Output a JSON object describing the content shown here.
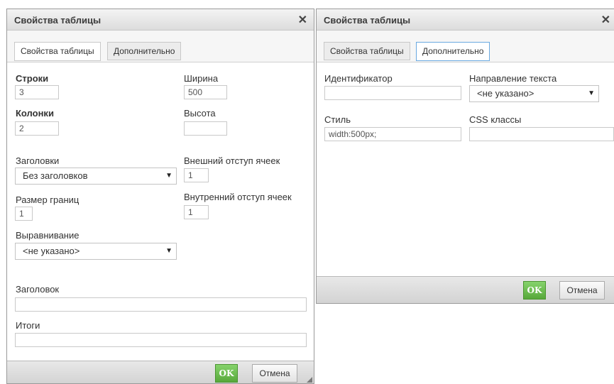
{
  "left": {
    "title": "Свойства таблицы",
    "close": "✕",
    "tabs": [
      "Свойства таблицы",
      "Дополнительно"
    ],
    "rows_label": "Строки",
    "rows_value": "3",
    "cols_label": "Колонки",
    "cols_value": "2",
    "width_label": "Ширина",
    "width_value": "500",
    "height_label": "Высота",
    "height_value": "",
    "headers_label": "Заголовки",
    "headers_value": "Без заголовков",
    "cellspacing_label": "Внешний отступ ячеек",
    "cellspacing_value": "1",
    "border_label": "Размер границ",
    "border_value": "1",
    "cellpadding_label": "Внутренний отступ ячеек",
    "cellpadding_value": "1",
    "align_label": "Выравнивание",
    "align_value": "<не указано>",
    "caption_label": "Заголовок",
    "caption_value": "",
    "summary_label": "Итоги",
    "summary_value": "",
    "ok": "OK",
    "cancel": "Отмена"
  },
  "right": {
    "title": "Свойства таблицы",
    "close": "✕",
    "tabs": [
      "Свойства таблицы",
      "Дополнительно"
    ],
    "id_label": "Идентификатор",
    "id_value": "",
    "dir_label": "Направление текста",
    "dir_value": "<не указано>",
    "style_label": "Стиль",
    "style_value": "width:500px;",
    "classes_label": "CSS классы",
    "classes_value": "",
    "ok": "OK",
    "cancel": "Отмена"
  },
  "icons": {
    "dropdown": "▼"
  }
}
